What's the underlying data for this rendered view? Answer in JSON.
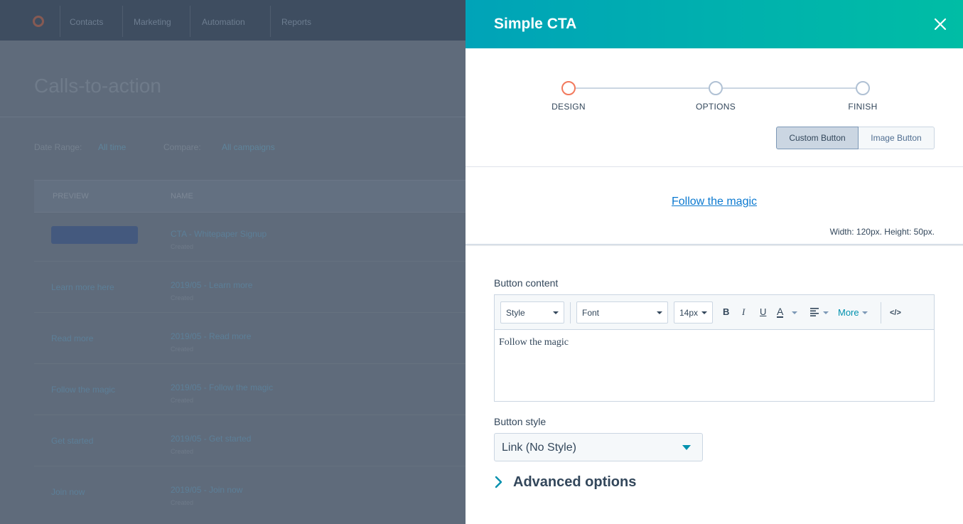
{
  "background": {
    "nav_items": [
      "Contacts",
      "Marketing",
      "Automation",
      "Reports"
    ],
    "page_title": "Calls-to-action",
    "filter_label_1": "Date Range:",
    "filter_value_1": "All time",
    "filter_label_2": "Compare:",
    "filter_value_2": "All campaigns",
    "table_headers": [
      "PREVIEW",
      "NAME"
    ],
    "rows": [
      {
        "preview": "",
        "name": "CTA - Whitepaper Signup",
        "sub": "Created"
      },
      {
        "preview": "Learn more here",
        "name": "2019/05 - Learn more",
        "sub": "Created"
      },
      {
        "preview": "Read more",
        "name": "2019/05 - Read more",
        "sub": "Created"
      },
      {
        "preview": "Follow the magic",
        "name": "2019/05 - Follow the magic",
        "sub": "Created"
      },
      {
        "preview": "Get started",
        "name": "2019/05 - Get started",
        "sub": "Created"
      },
      {
        "preview": "Join now",
        "name": "2019/05 - Join now",
        "sub": "Created"
      }
    ]
  },
  "panel": {
    "title": "Simple CTA",
    "steps": [
      "DESIGN",
      "OPTIONS",
      "FINISH"
    ],
    "active_step": "DESIGN",
    "button_types": [
      "Custom Button",
      "Image Button"
    ],
    "selected_button_type": "Custom Button",
    "preview": {
      "link_text": "Follow the magic",
      "dimensions": "Width: 120px. Height: 50px."
    },
    "button_content_label": "Button content",
    "toolbar": {
      "style": "Style",
      "font": "Font",
      "size": "14px",
      "bold": "B",
      "italic": "I",
      "underline": "U",
      "text_color": "A",
      "more": "More",
      "source": "</>"
    },
    "editor_text": "Follow the magic",
    "button_style_label": "Button style",
    "button_style_value": "Link (No Style)",
    "advanced_options": "Advanced options"
  },
  "colors": {
    "header_start": "#00a3b8",
    "header_end": "#00bda5",
    "active_step": "#f2795c",
    "link": "#0b79d0",
    "accent": "#0091ae"
  }
}
